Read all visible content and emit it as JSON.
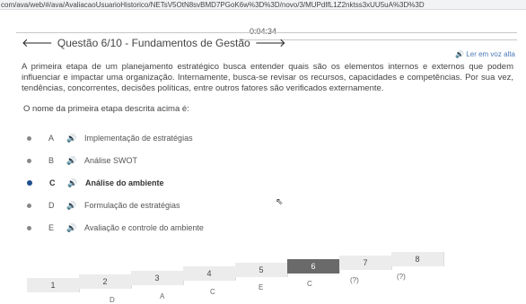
{
  "browser": {
    "url": "com/ava/web/#/ava/AvaliacaoUsuarioHistorico/NETsV5OtN8svBMD7PGoK6w%3D%3D/novo/3/MUPdIfL1Z2nktss3xUU5uA%3D%3D"
  },
  "timer": "0:04:34",
  "question": {
    "title": "Questão 6/10 - Fundamentos de Gestão",
    "read_aloud": "Ler em voz alta",
    "stem": "A primeira etapa de um planejamento estratégico busca entender quais são os elementos internos e externos que podem influenciar e impactar uma organização. Internamente, busca-se revisar os recursos, capacidades e competências. Por sua vez, tendências, concorrentes, decisões políticas, entre outros fatores são verificados externamente.",
    "prompt": "O nome da primeira etapa descrita acima é:"
  },
  "options": [
    {
      "letter": "A",
      "text": "Implementação de estratégias",
      "selected": false
    },
    {
      "letter": "B",
      "text": "Análise SWOT",
      "selected": false
    },
    {
      "letter": "C",
      "text": "Análise do ambiente",
      "selected": true
    },
    {
      "letter": "D",
      "text": "Formulação de estratégias",
      "selected": false
    },
    {
      "letter": "E",
      "text": "Avaliação e controle do ambiente",
      "selected": false
    }
  ],
  "nav": {
    "numbers": [
      "1",
      "2",
      "3",
      "4",
      "5",
      "6",
      "7",
      "8"
    ],
    "answers": [
      "D",
      "A",
      "C",
      "E",
      "C",
      "(?)",
      "(?)"
    ]
  }
}
